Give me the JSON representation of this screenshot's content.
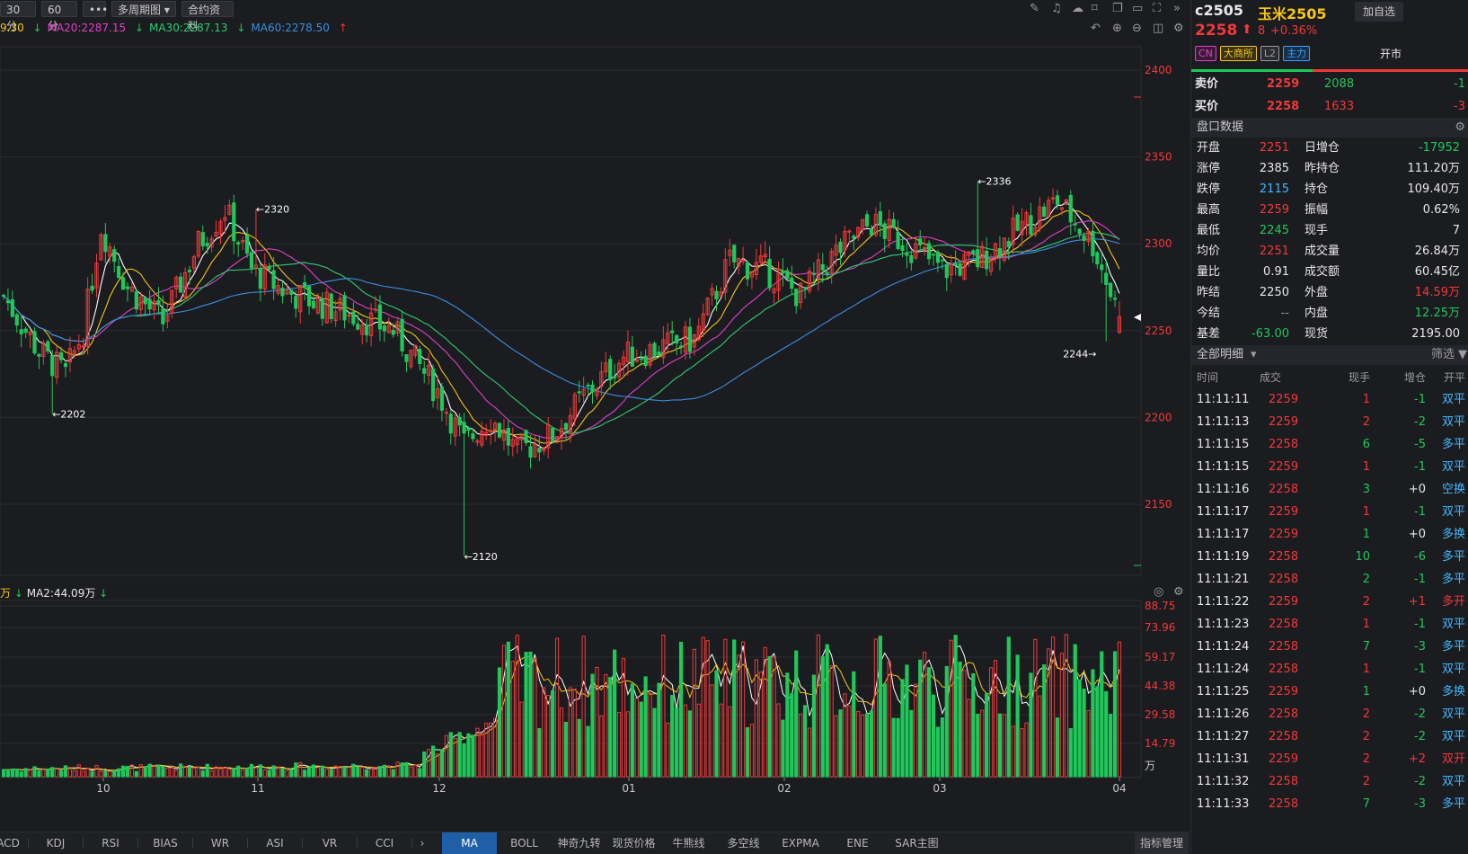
{
  "toolbar": {
    "btn_30": "30分",
    "btn_60": "60分",
    "btn_more": "•••",
    "btn_multi": "多周期图",
    "btn_contract": "合约资料"
  },
  "ma_legend": {
    "ma10_partial": "9.30",
    "ma20": "MA20:2287.15",
    "ma30": "MA30:2287.13",
    "ma60": "MA60:2278.50"
  },
  "price_axis": [
    "2400",
    "2350",
    "2300",
    "2250",
    "2200",
    "2150"
  ],
  "annotations": {
    "high1": "←2320",
    "low1": "←2202",
    "low2": "←2120",
    "high2": "←2336",
    "last": "2244→"
  },
  "volume_legend": {
    "prefix": "万",
    "ma2": "MA2:44.09万"
  },
  "volume_axis": [
    "88.75",
    "73.96",
    "59.17",
    "44.38",
    "29.58",
    "14.79",
    "万"
  ],
  "time_axis": [
    "10",
    "11",
    "12",
    "01",
    "02",
    "03",
    "04"
  ],
  "indicator_tabs_left": [
    "ACD",
    "KDJ",
    "RSI",
    "BIAS",
    "WR",
    "ASI",
    "VR",
    "CCI"
  ],
  "indicator_tabs_right": [
    "MA",
    "BOLL",
    "神奇九转",
    "现货价格",
    "牛熊线",
    "多空线",
    "EXPMA",
    "ENE",
    "SAR主图"
  ],
  "indicator_manage": "指标管理",
  "colors": {
    "up": "#f0393a",
    "down": "#1fc85a",
    "ma5": "#ffffff",
    "ma10": "#f5c518",
    "ma20": "#e040c8",
    "ma30": "#2ecc71",
    "ma60": "#3a8fe0"
  },
  "quote": {
    "code": "c2505",
    "name": "玉米2505",
    "add_btn": "加自选",
    "price": "2258",
    "change": "8",
    "pct": "+0.36%",
    "tags": [
      "CN",
      "大商所",
      "L2",
      "主力"
    ],
    "status": "开市",
    "ask_label": "卖价",
    "ask_price": "2259",
    "ask_vol": "2088",
    "ask_chg": "-1",
    "bid_label": "买价",
    "bid_price": "2258",
    "bid_vol": "1633",
    "bid_chg": "-3"
  },
  "pankou": {
    "title": "盘口数据",
    "rows": [
      {
        "l1": "开盘",
        "v1": "2251",
        "l2": "日增仓",
        "v2": "-17952"
      },
      {
        "l1": "涨停",
        "v1": "2385",
        "l2": "昨持仓",
        "v2": "111.20万"
      },
      {
        "l1": "跌停",
        "v1": "2115",
        "l2": "持仓",
        "v2": "109.40万"
      },
      {
        "l1": "最高",
        "v1": "2259",
        "l2": "振幅",
        "v2": "0.62%"
      },
      {
        "l1": "最低",
        "v1": "2245",
        "l2": "现手",
        "v2": "7"
      },
      {
        "l1": "均价",
        "v1": "2251",
        "l2": "成交量",
        "v2": "26.84万"
      },
      {
        "l1": "量比",
        "v1": "0.91",
        "l2": "成交额",
        "v2": "60.45亿"
      },
      {
        "l1": "昨结",
        "v1": "2250",
        "l2": "外盘",
        "v2": "14.59万"
      },
      {
        "l1": "今结",
        "v1": "--",
        "l2": "内盘",
        "v2": "12.25万"
      },
      {
        "l1": "基差",
        "v1": "-63.00",
        "l2": "现货",
        "v2": "2195.00"
      }
    ]
  },
  "ticks": {
    "title": "全部明细",
    "filter": "筛选",
    "headers": [
      "时间",
      "成交",
      "现手",
      "增仓",
      "开平"
    ],
    "rows": [
      {
        "t": "11:11:11",
        "p": "2259",
        "v": "1",
        "oi": "-1",
        "type": "双平"
      },
      {
        "t": "11:11:13",
        "p": "2259",
        "v": "2",
        "oi": "-2",
        "type": "双平"
      },
      {
        "t": "11:11:15",
        "p": "2258",
        "v": "6",
        "oi": "-5",
        "type": "多平"
      },
      {
        "t": "11:11:15",
        "p": "2259",
        "v": "1",
        "oi": "-1",
        "type": "双平"
      },
      {
        "t": "11:11:16",
        "p": "2258",
        "v": "3",
        "oi": "+0",
        "type": "空换"
      },
      {
        "t": "11:11:17",
        "p": "2259",
        "v": "1",
        "oi": "-1",
        "type": "双平"
      },
      {
        "t": "11:11:17",
        "p": "2259",
        "v": "1",
        "oi": "+0",
        "type": "多换"
      },
      {
        "t": "11:11:19",
        "p": "2258",
        "v": "10",
        "oi": "-6",
        "type": "多平"
      },
      {
        "t": "11:11:21",
        "p": "2258",
        "v": "2",
        "oi": "-1",
        "type": "多平"
      },
      {
        "t": "11:11:22",
        "p": "2259",
        "v": "2",
        "oi": "+1",
        "type": "多开"
      },
      {
        "t": "11:11:23",
        "p": "2258",
        "v": "1",
        "oi": "-1",
        "type": "双平"
      },
      {
        "t": "11:11:24",
        "p": "2258",
        "v": "7",
        "oi": "-3",
        "type": "多平"
      },
      {
        "t": "11:11:24",
        "p": "2258",
        "v": "1",
        "oi": "-1",
        "type": "双平"
      },
      {
        "t": "11:11:25",
        "p": "2259",
        "v": "1",
        "oi": "+0",
        "type": "多换"
      },
      {
        "t": "11:11:26",
        "p": "2258",
        "v": "2",
        "oi": "-2",
        "type": "双平"
      },
      {
        "t": "11:11:27",
        "p": "2258",
        "v": "2",
        "oi": "-2",
        "type": "双平"
      },
      {
        "t": "11:11:31",
        "p": "2259",
        "v": "2",
        "oi": "+2",
        "type": "双开"
      },
      {
        "t": "11:11:32",
        "p": "2258",
        "v": "2",
        "oi": "-2",
        "type": "双平"
      },
      {
        "t": "11:11:33",
        "p": "2258",
        "v": "7",
        "oi": "-3",
        "type": "多平"
      }
    ]
  }
}
